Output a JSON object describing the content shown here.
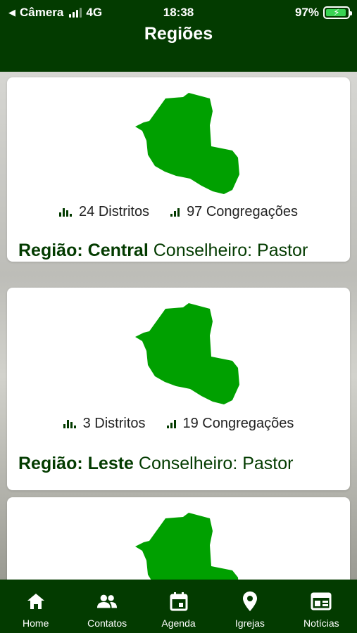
{
  "status_bar": {
    "back_app": "Câmera",
    "network": "4G",
    "time": "18:38",
    "battery": "97%"
  },
  "header": {
    "title": "Regiões"
  },
  "regions": [
    {
      "districts": "24 Distritos",
      "congregations": "97 Congregações",
      "label": "Região:",
      "name": "Central",
      "counselor": "Conselheiro: Pastor"
    },
    {
      "districts": "3 Distritos",
      "congregations": "19 Congregações",
      "label": "Região:",
      "name": "Leste",
      "counselor": "Conselheiro: Pastor"
    },
    {}
  ],
  "tabbar": {
    "items": [
      {
        "label": "Home",
        "icon": "home-icon"
      },
      {
        "label": "Contatos",
        "icon": "people-icon"
      },
      {
        "label": "Agenda",
        "icon": "calendar-icon"
      },
      {
        "label": "Igrejas",
        "icon": "location-icon"
      },
      {
        "label": "Notícias",
        "icon": "news-icon"
      }
    ]
  },
  "colors": {
    "brand_dark_green": "#033b00",
    "map_green": "#00a000"
  }
}
